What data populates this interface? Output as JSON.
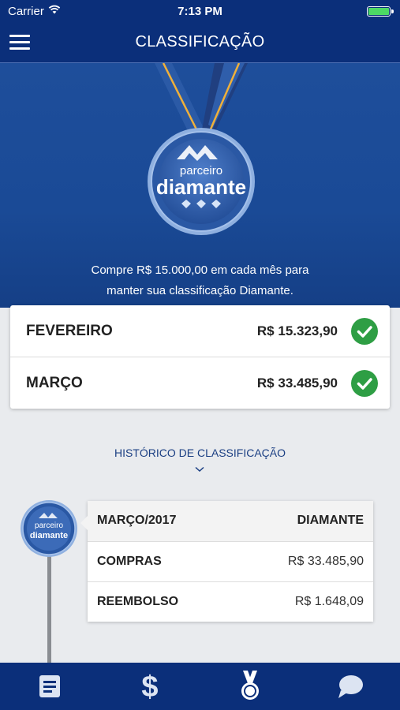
{
  "status_bar": {
    "carrier": "Carrier",
    "time": "7:13 PM"
  },
  "header": {
    "title": "CLASSIFICAÇÃO"
  },
  "hero": {
    "badge_line1": "parceiro",
    "badge_line2": "diamante",
    "message_line1": "Compre R$ 15.000,00 em cada mês para",
    "message_line2": "manter sua classificação Diamante."
  },
  "months": [
    {
      "name": "FEVEREIRO",
      "value": "R$ 15.323,90",
      "status": "check-icon"
    },
    {
      "name": "MARÇO",
      "value": "R$ 33.485,90",
      "status": "check-icon"
    }
  ],
  "history": {
    "title": "HISTÓRICO DE CLASSIFICAÇÃO",
    "badge_line1": "parceiro",
    "badge_line2": "diamante",
    "rows": [
      {
        "label": "MARÇO/2017",
        "value": "DIAMANTE"
      },
      {
        "label": "COMPRAS",
        "value": "R$ 33.485,90"
      },
      {
        "label": "REEMBOLSO",
        "value": "R$ 1.648,09"
      }
    ]
  },
  "tabs": [
    {
      "icon": "document-icon"
    },
    {
      "icon": "dollar-icon"
    },
    {
      "icon": "medal-icon",
      "active": true
    },
    {
      "icon": "chat-icon"
    }
  ],
  "colors": {
    "brand": "#0b2f7a",
    "hero": "#1e4e9b",
    "success": "#2e9e44",
    "link": "#1b3f83"
  }
}
